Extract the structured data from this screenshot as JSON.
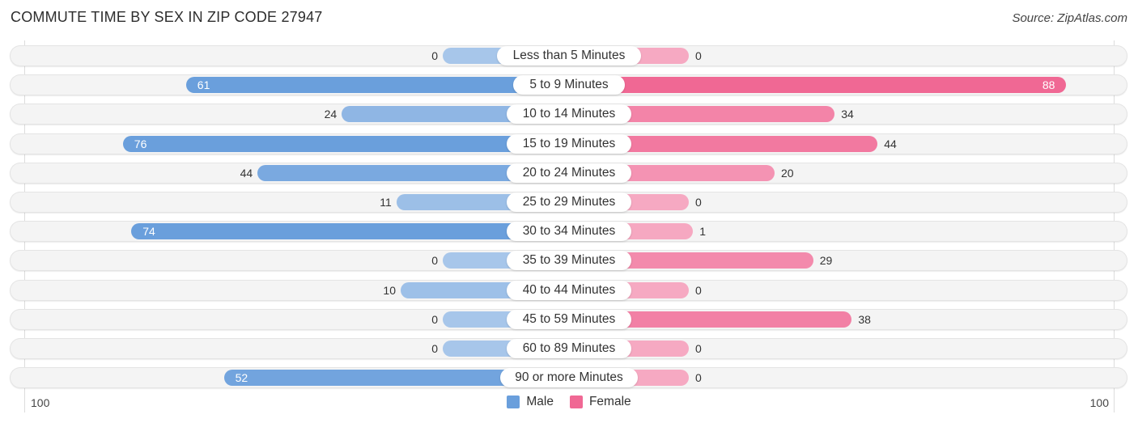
{
  "header": {
    "title": "COMMUTE TIME BY SEX IN ZIP CODE 27947",
    "source": "Source: ZipAtlas.com"
  },
  "colors": {
    "male_dark": "#6a9fdc",
    "male_light": "#a7c6ea",
    "female_dark": "#f06894",
    "female_light": "#f6a9c2"
  },
  "axis": {
    "left_label": "100",
    "right_label": "100"
  },
  "legend": {
    "male": "Male",
    "female": "Female"
  },
  "chart_data": {
    "type": "bar",
    "orientation": "horizontal-diverging",
    "title": "COMMUTE TIME BY SEX IN ZIP CODE 27947",
    "source": "Source: ZipAtlas.com",
    "xlim": [
      -100,
      100
    ],
    "axis_tick_labels": [
      "100",
      "100"
    ],
    "legend_position": "bottom-center",
    "categories": [
      "Less than 5 Minutes",
      "5 to 9 Minutes",
      "10 to 14 Minutes",
      "15 to 19 Minutes",
      "20 to 24 Minutes",
      "25 to 29 Minutes",
      "30 to 34 Minutes",
      "35 to 39 Minutes",
      "40 to 44 Minutes",
      "45 to 59 Minutes",
      "60 to 89 Minutes",
      "90 or more Minutes"
    ],
    "series": [
      {
        "name": "Male",
        "values": [
          0,
          61,
          24,
          76,
          44,
          11,
          74,
          0,
          10,
          0,
          0,
          52
        ]
      },
      {
        "name": "Female",
        "values": [
          0,
          88,
          34,
          44,
          20,
          0,
          1,
          29,
          0,
          38,
          0,
          0
        ]
      }
    ]
  }
}
